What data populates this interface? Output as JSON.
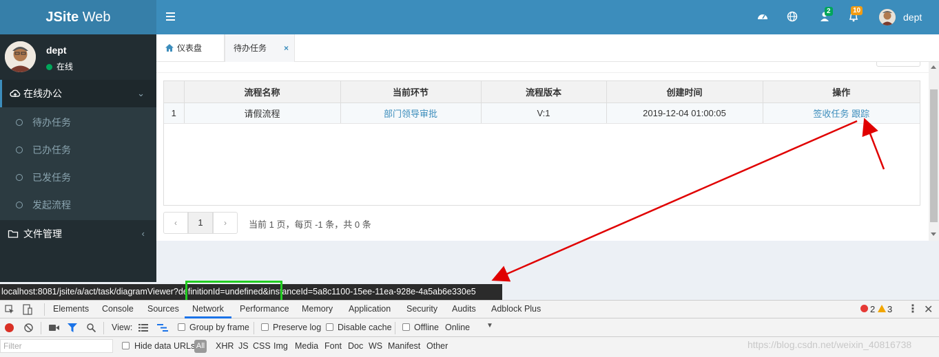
{
  "app": {
    "brand_bold": "JSite",
    "brand_rest": " Web"
  },
  "topbar": {
    "messages_badge": "2",
    "notifications_badge": "10",
    "user_name": "dept",
    "icons": [
      "dashboard-icon",
      "globe-icon",
      "user-icon",
      "bell-icon"
    ]
  },
  "sidebar": {
    "user": {
      "name": "dept",
      "status": "在线"
    },
    "menus": [
      {
        "label": "在线办公",
        "icon": "cloud-icon",
        "expanded": true,
        "items": [
          {
            "label": "待办任务"
          },
          {
            "label": "已办任务"
          },
          {
            "label": "已发任务"
          },
          {
            "label": "发起流程"
          }
        ]
      },
      {
        "label": "文件管理",
        "icon": "folder-icon",
        "expanded": false
      }
    ]
  },
  "tabs": [
    {
      "label": "仪表盘",
      "icon": "home-icon"
    },
    {
      "label": "待办任务",
      "close": "×"
    }
  ],
  "table": {
    "headers": [
      "",
      "流程名称",
      "当前环节",
      "流程版本",
      "创建时间",
      "操作"
    ],
    "rows": [
      {
        "index": "1",
        "name": "请假流程",
        "step": "部门领导审批",
        "version": "V:1",
        "created": "2019-12-04 01:00:05",
        "action_sign": "签收任务",
        "action_track": "跟踪"
      }
    ]
  },
  "pager": {
    "prev": "‹",
    "current": "1",
    "next": "›",
    "info": "当前 1 页，每页 -1 条，共 0 条"
  },
  "status_url": {
    "prefix": "localhost:8081/jsite/a/act/task/diagramViewer?",
    "highlight": "definitionId=undefined",
    "suffix": "&instanceId=5a8c1100-15ee-11ea-928e-4a5ab6e330e5"
  },
  "devtools": {
    "tabs": [
      "Elements",
      "Console",
      "Sources",
      "Network",
      "Performance",
      "Memory",
      "Application",
      "Security",
      "Audits",
      "Adblock Plus"
    ],
    "active_tab": "Network",
    "errors": "2",
    "warnings": "3",
    "toolbar": {
      "view_label": "View:",
      "group_by_frame": "Group by frame",
      "preserve_log": "Preserve log",
      "disable_cache": "Disable cache",
      "offline": "Offline",
      "throttle": "Online"
    },
    "filter_placeholder": "Filter",
    "hide_data_urls": "Hide data URLs",
    "types": [
      "All",
      "XHR",
      "JS",
      "CSS",
      "Img",
      "Media",
      "Font",
      "Doc",
      "WS",
      "Manifest",
      "Other"
    ]
  },
  "watermark": "https://blog.csdn.net/weixin_40816738",
  "colors": {
    "header": "#3c8dbc",
    "brand": "#367fa9",
    "sidebar": "#222d32",
    "annotation_arrow": "#e00000",
    "annotation_box": "#22cc22"
  }
}
